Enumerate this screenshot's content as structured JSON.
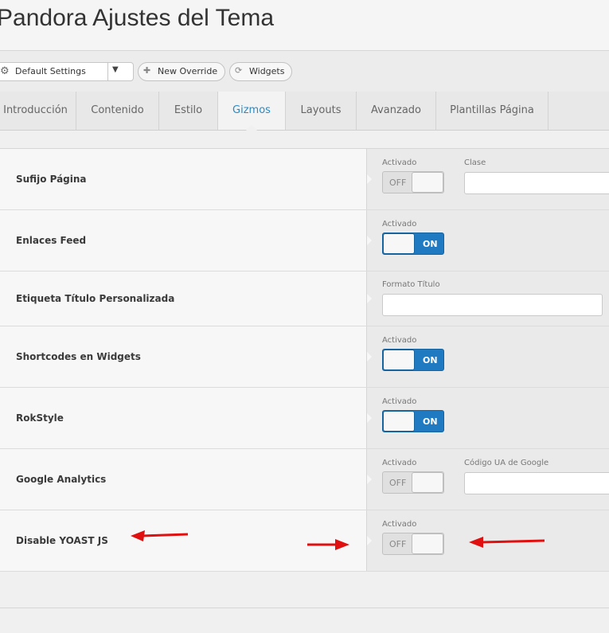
{
  "header": {
    "title": "Pandora Ajustes del Tema"
  },
  "toolbar": {
    "select_value": "Default Settings",
    "new_override_label": "New Override",
    "widgets_label": "Widgets"
  },
  "tabs": [
    {
      "label": "Introducción",
      "active": false
    },
    {
      "label": "Contenido",
      "active": false
    },
    {
      "label": "Estilo",
      "active": false
    },
    {
      "label": "Gizmos",
      "active": true
    },
    {
      "label": "Layouts",
      "active": false
    },
    {
      "label": "Avanzado",
      "active": false
    },
    {
      "label": "Plantillas Página",
      "active": false
    }
  ],
  "rows": [
    {
      "label": "Sufijo Página",
      "enabled_label": "Activado",
      "toggle": "OFF",
      "extra_label": "Clase",
      "extra_value": ""
    },
    {
      "label": "Enlaces Feed",
      "enabled_label": "Activado",
      "toggle": "ON"
    },
    {
      "label": "Etiqueta Título Personalizada",
      "field_label": "Formato Título",
      "field_value": ""
    },
    {
      "label": "Shortcodes en Widgets",
      "enabled_label": "Activado",
      "toggle": "ON"
    },
    {
      "label": "RokStyle",
      "enabled_label": "Activado",
      "toggle": "ON"
    },
    {
      "label": "Google Analytics",
      "enabled_label": "Activado",
      "toggle": "OFF",
      "extra_label": "Código UA de Google",
      "extra_value": ""
    },
    {
      "label": "Disable YOAST JS",
      "enabled_label": "Activado",
      "toggle": "OFF"
    }
  ],
  "colors": {
    "accent": "#1f7ac2",
    "active_tab": "#2a8ac4",
    "annotation_arrow": "#e01010"
  },
  "icons": {
    "select": "gear-icon",
    "new_override": "plus-icon",
    "widgets": "refresh-icon"
  }
}
